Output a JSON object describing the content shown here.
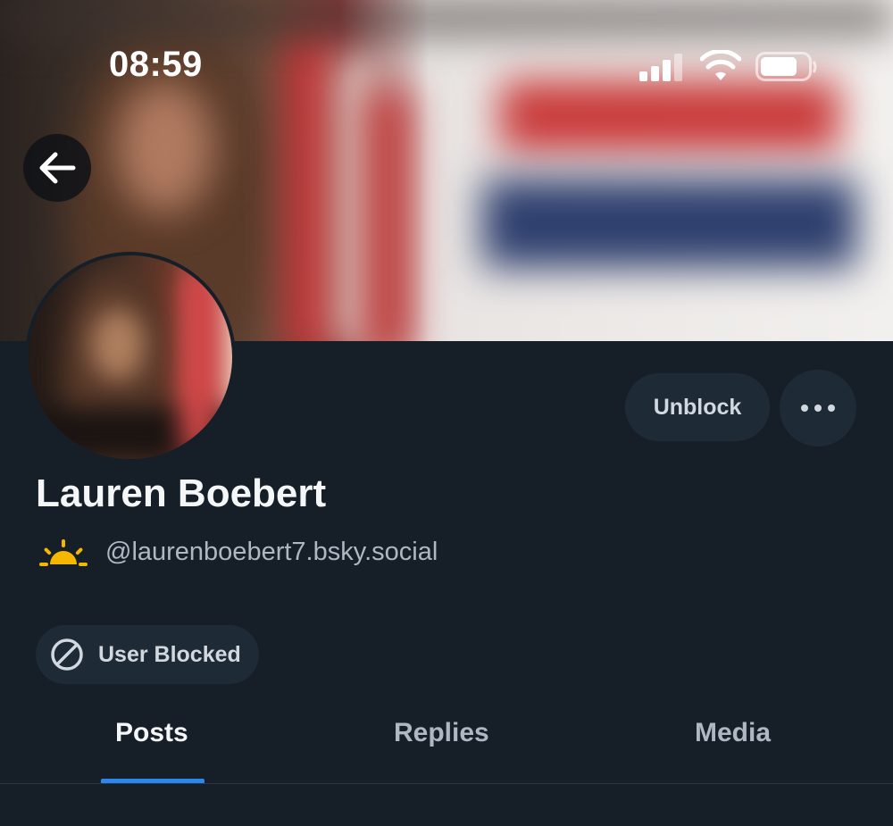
{
  "status_bar": {
    "time": "08:59",
    "icons": [
      "cellular-signal-icon",
      "wifi-icon",
      "battery-icon"
    ]
  },
  "profile": {
    "display_name": "Lauren Boebert",
    "handle": "@laurenboebert7.bsky.social",
    "handle_emoji": "sunrise-icon",
    "badge": "User Blocked"
  },
  "actions": {
    "unblock_label": "Unblock",
    "more_icon": "more-options-icon",
    "back_icon": "back-arrow-icon"
  },
  "tabs": [
    {
      "label": "Posts",
      "active": true
    },
    {
      "label": "Replies",
      "active": false
    },
    {
      "label": "Media",
      "active": false
    }
  ],
  "colors": {
    "background": "#161e27",
    "pill": "#1f2a37",
    "accent": "#2a87f0",
    "muted_text": "#aeb7c2",
    "emoji_yellow": "#f5b700"
  }
}
